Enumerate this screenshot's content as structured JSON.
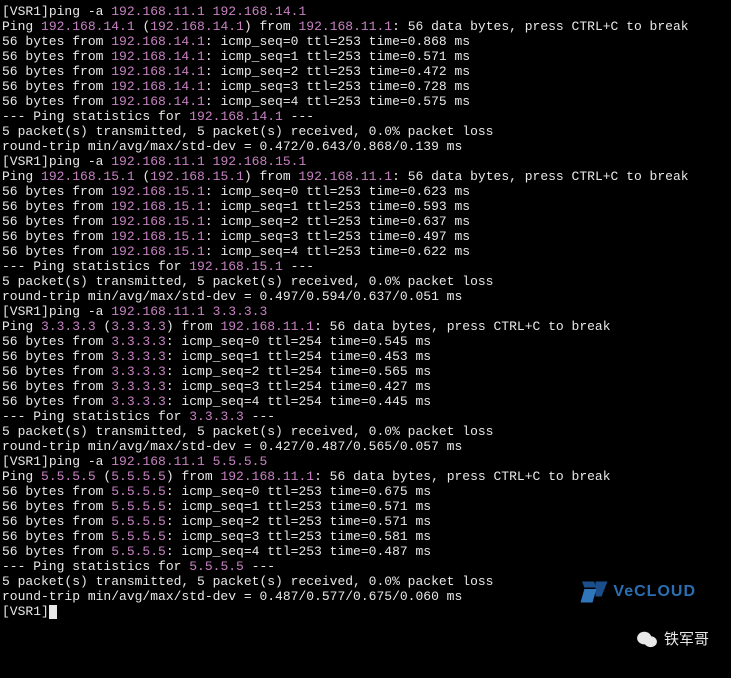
{
  "colors": {
    "ip": "#c781c2",
    "text": "#e8e8e8",
    "bg": "#000000"
  },
  "watermark": {
    "brand": "VeCLOUD",
    "author_label": "铁军哥"
  },
  "ping_sessions": [
    {
      "prompt": "[VSR1]",
      "cmd_prefix": "ping -a ",
      "src_ip": "192.168.11.1",
      "dst_ip": "192.168.14.1",
      "header_ip1": "192.168.14.1",
      "header_ip2": "192.168.14.1",
      "from_ip": "192.168.11.1",
      "header_tail": ": 56 data bytes, press CTRL+C to break",
      "reply_ip": "192.168.14.1",
      "replies": [
        {
          "seq": 0,
          "ttl": 253,
          "time": "0.868"
        },
        {
          "seq": 1,
          "ttl": 253,
          "time": "0.571"
        },
        {
          "seq": 2,
          "ttl": 253,
          "time": "0.472"
        },
        {
          "seq": 3,
          "ttl": 253,
          "time": "0.728"
        },
        {
          "seq": 4,
          "ttl": 253,
          "time": "0.575"
        }
      ],
      "stats_ip": "192.168.14.1",
      "stats_line": "5 packet(s) transmitted, 5 packet(s) received, 0.0% packet loss",
      "rtt_line": "round-trip min/avg/max/std-dev = 0.472/0.643/0.868/0.139 ms"
    },
    {
      "prompt": "[VSR1]",
      "cmd_prefix": "ping -a ",
      "src_ip": "192.168.11.1",
      "dst_ip": "192.168.15.1",
      "header_ip1": "192.168.15.1",
      "header_ip2": "192.168.15.1",
      "from_ip": "192.168.11.1",
      "header_tail": ": 56 data bytes, press CTRL+C to break",
      "reply_ip": "192.168.15.1",
      "replies": [
        {
          "seq": 0,
          "ttl": 253,
          "time": "0.623"
        },
        {
          "seq": 1,
          "ttl": 253,
          "time": "0.593"
        },
        {
          "seq": 2,
          "ttl": 253,
          "time": "0.637"
        },
        {
          "seq": 3,
          "ttl": 253,
          "time": "0.497"
        },
        {
          "seq": 4,
          "ttl": 253,
          "time": "0.622"
        }
      ],
      "stats_ip": "192.168.15.1",
      "stats_line": "5 packet(s) transmitted, 5 packet(s) received, 0.0% packet loss",
      "rtt_line": "round-trip min/avg/max/std-dev = 0.497/0.594/0.637/0.051 ms"
    },
    {
      "prompt": "[VSR1]",
      "cmd_prefix": "ping -a ",
      "src_ip": "192.168.11.1",
      "dst_ip": "3.3.3.3",
      "header_ip1": "3.3.3.3",
      "header_ip2": "3.3.3.3",
      "from_ip": "192.168.11.1",
      "header_tail": ": 56 data bytes, press CTRL+C to break",
      "reply_ip": "3.3.3.3",
      "replies": [
        {
          "seq": 0,
          "ttl": 254,
          "time": "0.545"
        },
        {
          "seq": 1,
          "ttl": 254,
          "time": "0.453"
        },
        {
          "seq": 2,
          "ttl": 254,
          "time": "0.565"
        },
        {
          "seq": 3,
          "ttl": 254,
          "time": "0.427"
        },
        {
          "seq": 4,
          "ttl": 254,
          "time": "0.445"
        }
      ],
      "stats_ip": "3.3.3.3",
      "stats_line": "5 packet(s) transmitted, 5 packet(s) received, 0.0% packet loss",
      "rtt_line": "round-trip min/avg/max/std-dev = 0.427/0.487/0.565/0.057 ms"
    },
    {
      "prompt": "[VSR1]",
      "cmd_prefix": "ping -a ",
      "src_ip": "192.168.11.1",
      "dst_ip": "5.5.5.5",
      "header_ip1": "5.5.5.5",
      "header_ip2": "5.5.5.5",
      "from_ip": "192.168.11.1",
      "header_tail": ": 56 data bytes, press CTRL+C to break",
      "reply_ip": "5.5.5.5",
      "replies": [
        {
          "seq": 0,
          "ttl": 253,
          "time": "0.675"
        },
        {
          "seq": 1,
          "ttl": 253,
          "time": "0.571"
        },
        {
          "seq": 2,
          "ttl": 253,
          "time": "0.571"
        },
        {
          "seq": 3,
          "ttl": 253,
          "time": "0.581"
        },
        {
          "seq": 4,
          "ttl": 253,
          "time": "0.487"
        }
      ],
      "stats_ip": "5.5.5.5",
      "stats_line": "5 packet(s) transmitted, 5 packet(s) received, 0.0% packet loss",
      "rtt_line": "round-trip min/avg/max/std-dev = 0.487/0.577/0.675/0.060 ms"
    }
  ],
  "final_prompt": "[VSR1]"
}
